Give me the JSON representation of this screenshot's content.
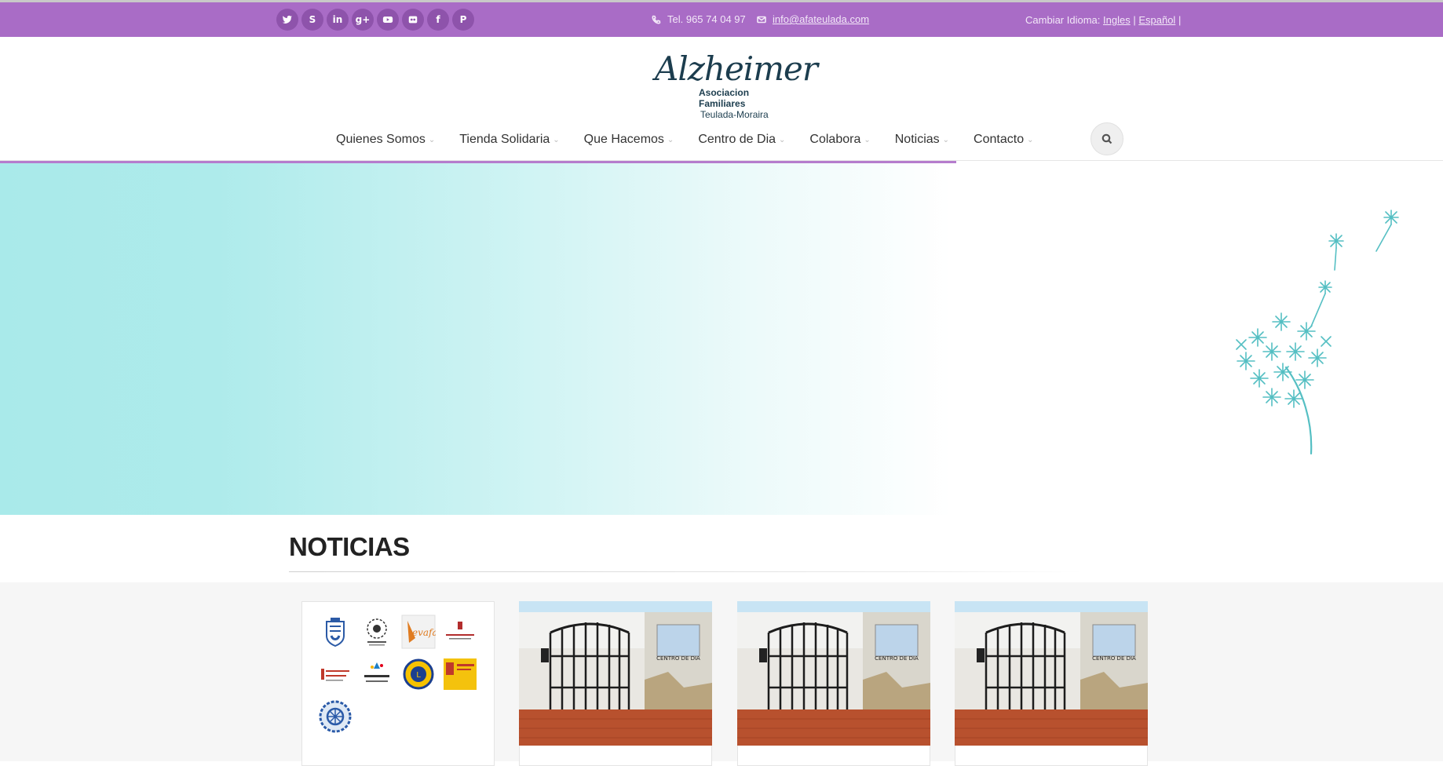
{
  "topbar": {
    "social_icons": [
      "twitter-icon",
      "skype-icon",
      "linkedin-icon",
      "google-plus-icon",
      "youtube-icon",
      "flickr-icon",
      "facebook-icon",
      "pinterest-icon"
    ],
    "phone": "Tel. 965 74 04 97",
    "email": "info@afateulada.com",
    "lang_label": "Cambiar Idioma:",
    "lang_en": "Ingles",
    "lang_es": "Español",
    "lang_sep": "|"
  },
  "header": {
    "logo_script": "Alzheimer",
    "logo_line1": "Asociacion Familiares",
    "logo_line2": "Teulada-Moraira"
  },
  "nav": {
    "items": [
      {
        "label": "Quienes Somos"
      },
      {
        "label": "Tienda Solidaria"
      },
      {
        "label": "Que Hacemos"
      },
      {
        "label": "Centro de Dia"
      },
      {
        "label": "Colabora"
      },
      {
        "label": "Noticias"
      },
      {
        "label": "Contacto"
      }
    ]
  },
  "news": {
    "heading": "NOTICIAS",
    "sign_text": "CENTRO DE DIA"
  },
  "colors": {
    "topbar": "#a96cc6",
    "social_bg": "#8e53ab",
    "hero_cyan": "#a9eaea",
    "dandelion": "#55bfc3"
  }
}
